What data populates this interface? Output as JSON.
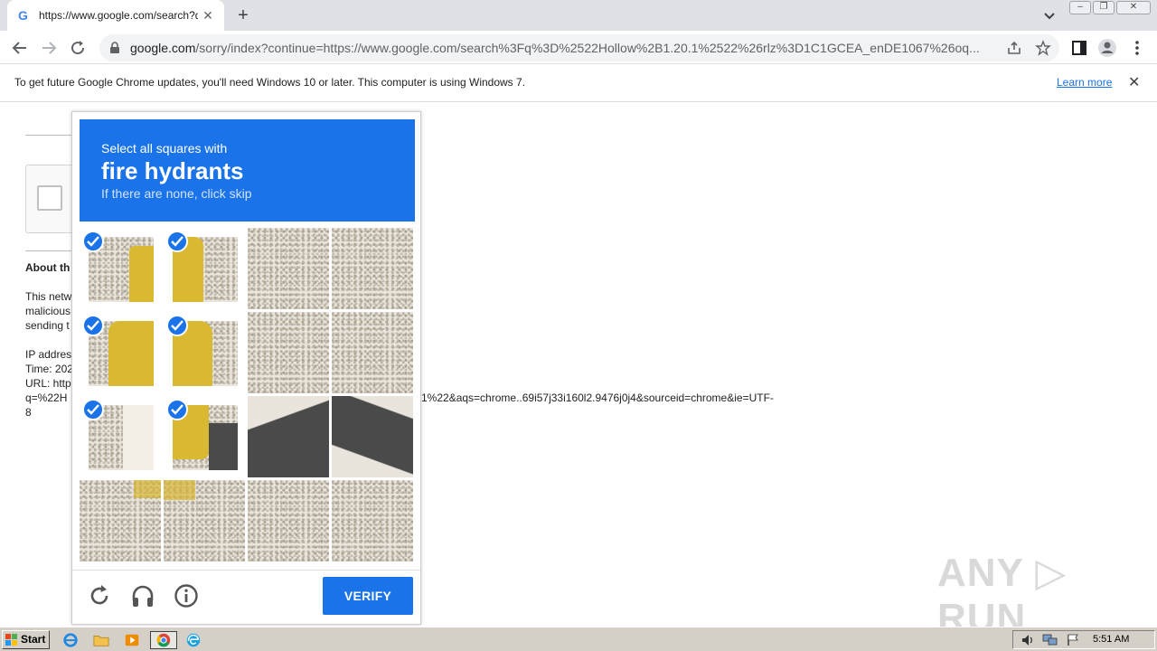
{
  "browser": {
    "tab_title": "https://www.google.com/search?q=",
    "tab_close": "✕",
    "new_tab": "+",
    "url_host": "google.com",
    "url_rest": "/sorry/index?continue=https://www.google.com/search%3Fq%3D%2522Hollow%2B1.20.1%2522%26rlz%3D1C1GCEA_enDE1067%26oq...",
    "window_controls": [
      "–",
      "❐",
      "✕"
    ]
  },
  "infobar": {
    "message": "To get future Google Chrome updates, you'll need Windows 10 or later. This computer is using Windows 7.",
    "learn_more": "Learn more",
    "close": "✕"
  },
  "background_page": {
    "about_heading": "About th",
    "para_lines": [
      "This netw",
      "malicious",
      "sending t"
    ],
    "ip_label": "IP addres",
    "time_label": "Time: 202",
    "url_label": "URL: http",
    "url_line2_left": "q=%22H",
    "url_line2_right": "1%22&aqs=chrome..69i57j33i160l2.9476j0j4&sourceid=chrome&ie=UTF-",
    "url_line3": "8"
  },
  "captcha": {
    "instruction_line1": "Select all squares with",
    "target": "fire hydrants",
    "instruction_line3": "If there are none, click skip",
    "verify_label": "VERIFY",
    "selected_tiles": [
      0,
      1,
      4,
      5,
      8,
      9
    ]
  },
  "watermark": "ANY ▷ RUN",
  "taskbar": {
    "start_label": "Start",
    "clock": "5:51 AM"
  }
}
